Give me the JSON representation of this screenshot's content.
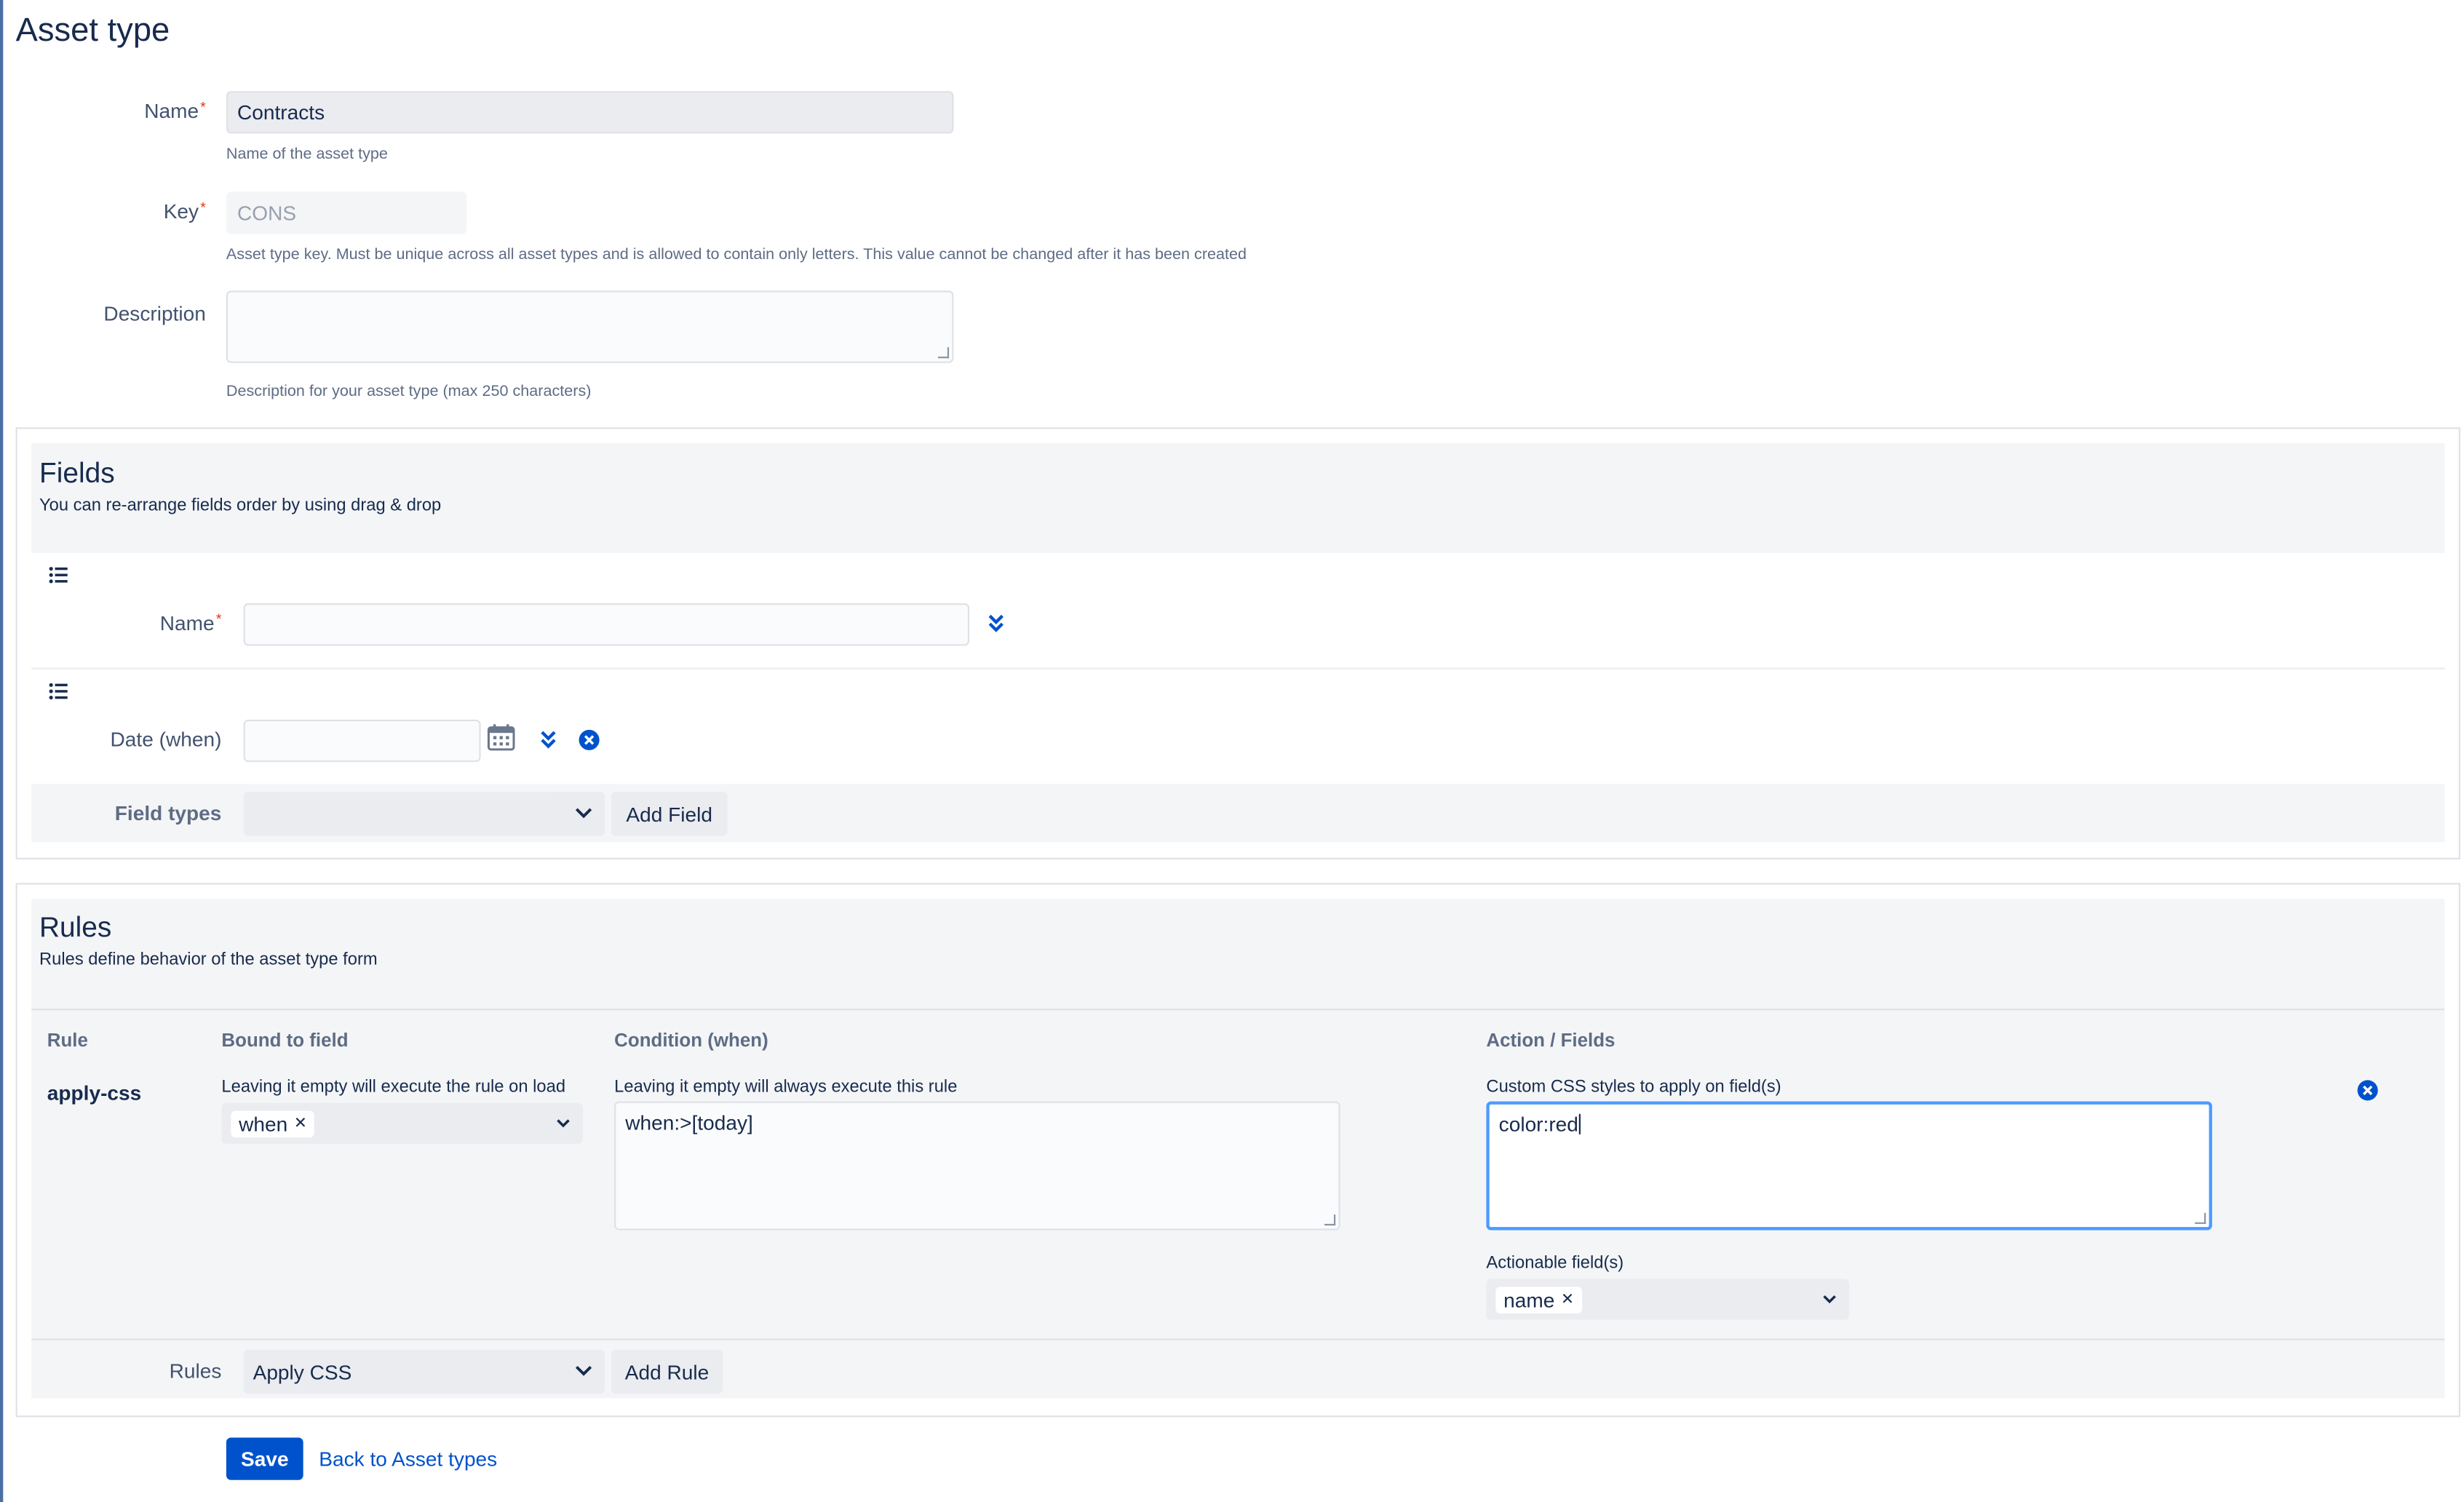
{
  "page": {
    "title": "Asset type"
  },
  "form": {
    "name": {
      "label": "Name",
      "required": "*",
      "value": "Contracts",
      "help": "Name of the asset type"
    },
    "key": {
      "label": "Key",
      "required": "*",
      "value": "CONS",
      "help": "Asset type key. Must be unique across all asset types and is allowed to contain only letters. This value cannot be changed after it has been created"
    },
    "description": {
      "label": "Description",
      "value": "",
      "help": "Description for your asset type (max 250 characters)"
    }
  },
  "fields_section": {
    "title": "Fields",
    "subtitle": "You can re-arrange fields order by using drag & drop",
    "items": [
      {
        "label": "Name",
        "required": "*",
        "value": ""
      },
      {
        "label": "Date (when)",
        "value": ""
      }
    ],
    "field_types_label": "Field types",
    "field_types_value": "",
    "add_field_label": "Add Field"
  },
  "rules_section": {
    "title": "Rules",
    "subtitle": "Rules define behavior of the asset type form",
    "columns": [
      "Rule",
      "Bound to field",
      "Condition (when)",
      "Action / Fields"
    ],
    "rule": {
      "name": "apply-css",
      "bound_help": "Leaving it empty will execute the rule on load",
      "bound_tag": "when",
      "condition_help": "Leaving it empty will always execute this rule",
      "condition_value": "when:>[today]",
      "action_help": "Custom CSS styles to apply on field(s)",
      "action_value": "color:red",
      "actionable_label": "Actionable field(s)",
      "actionable_tag": "name"
    },
    "rules_label": "Rules",
    "rules_select_value": "Apply CSS",
    "add_rule_label": "Add Rule"
  },
  "footer": {
    "save_label": "Save",
    "back_label": "Back to Asset types"
  },
  "colors": {
    "primary": "#0052cc",
    "required": "#de350b",
    "panel": "#f4f5f7"
  }
}
